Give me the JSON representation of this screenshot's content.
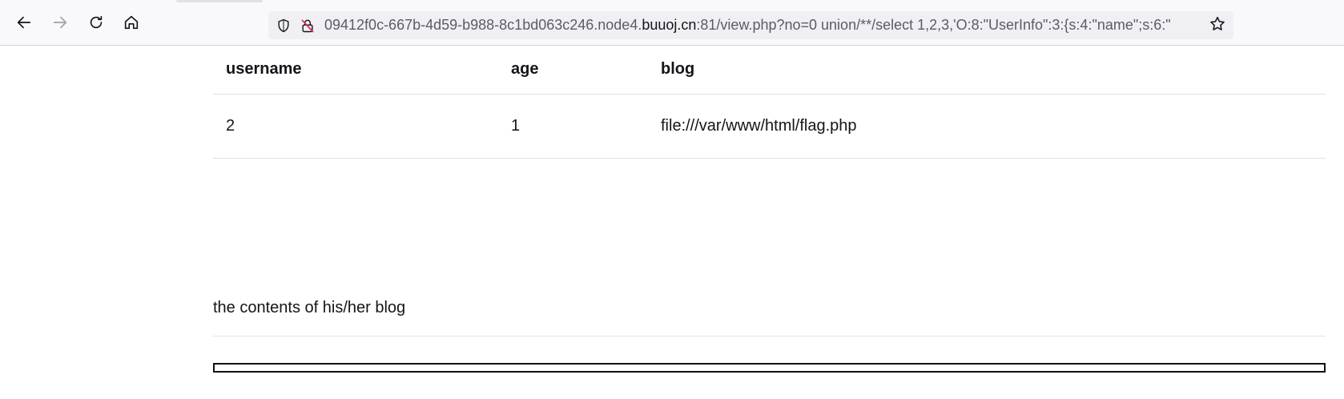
{
  "browser": {
    "url_prefix": "09412f0c-667b-4d59-b988-8c1bd063c246.node4.",
    "url_host": "buuoj.cn",
    "url_suffix": ":81/view.php?no=0 union/**/select 1,2,3,'O:8:\"UserInfo\":3:{s:4:\"name\";s:6:\"",
    "icons": {
      "back": "arrow-left-icon",
      "forward": "arrow-right-icon",
      "reload": "reload-icon",
      "home": "home-icon",
      "tracking": "shield-icon",
      "insecure": "insecure-lock-icon",
      "bookmark": "star-icon"
    }
  },
  "table": {
    "headers": [
      "username",
      "age",
      "blog"
    ],
    "rows": [
      [
        "2",
        "1",
        "file:///var/www/html/flag.php"
      ]
    ]
  },
  "blog_section": {
    "heading": "the contents of his/her blog"
  },
  "colors": {
    "toolbar_bg": "#f9f9fb",
    "urlbar_bg": "#f0f0f4",
    "insecure_red": "#e22850",
    "text": "#15141a"
  }
}
